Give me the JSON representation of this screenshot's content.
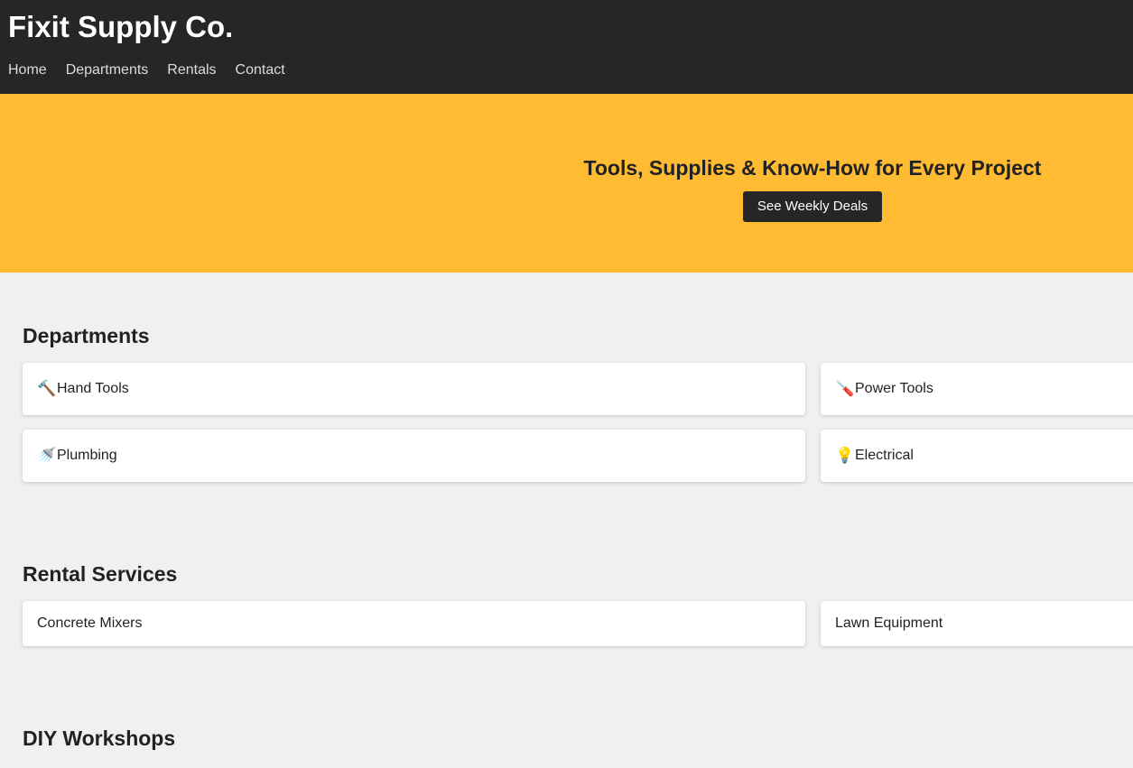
{
  "header": {
    "brand": "Fixit Supply Co.",
    "nav": [
      "Home",
      "Departments",
      "Rentals",
      "Contact"
    ]
  },
  "hero": {
    "title": "Tools, Supplies & Know-How for Every Project",
    "cta": "See Weekly Deals"
  },
  "departments": {
    "title": "Departments",
    "items": [
      {
        "icon": "🔨",
        "icon_name": "hammer-icon",
        "label": "Hand Tools"
      },
      {
        "icon": "🪛",
        "icon_name": "drill-icon",
        "label": "Power Tools"
      },
      {
        "icon": "🚿",
        "icon_name": "faucet-icon",
        "label": "Plumbing"
      },
      {
        "icon": "💡",
        "icon_name": "lightbulb-icon",
        "label": "Electrical"
      }
    ]
  },
  "rentals": {
    "title": "Rental Services",
    "items": [
      "Concrete Mixers",
      "Lawn Equipment"
    ]
  },
  "workshops": {
    "title": "DIY Workshops"
  },
  "colors": {
    "header_bg": "#262626",
    "hero_bg": "#ffbc33",
    "page_bg": "#f0f0f0",
    "button_bg": "#262626"
  }
}
